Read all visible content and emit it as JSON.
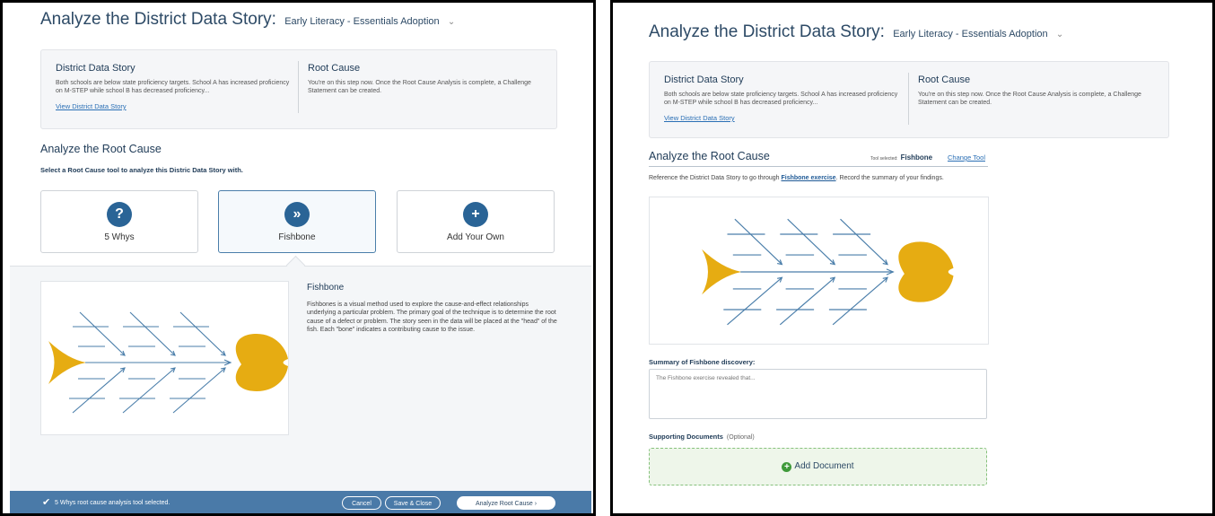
{
  "header": {
    "title": "Analyze the District Data Story:",
    "plan": "Early Literacy - Essentials Adoption",
    "chevron_icon": "chevron-down-icon"
  },
  "data_story": {
    "heading": "District Data Story",
    "text": "Both schools are below state proficiency targets. School A has increased proficiency on M-STEP while school B has decreased proficiency...",
    "link": "View District Data Story"
  },
  "root_cause": {
    "heading": "Root Cause",
    "text": "You're on this step now. Once the Root Cause Analysis is complete, a Challenge Statement can be created."
  },
  "left": {
    "section_title": "Analyze the Root Cause",
    "prompt": "Select a Root Cause tool to analyze this Distric Data Story with.",
    "tools": [
      {
        "label": "5 Whys",
        "glyph": "?",
        "icon": "question-icon"
      },
      {
        "label": "Fishbone",
        "glyph": "»",
        "icon": "double-chevron-right-icon"
      },
      {
        "label": "Add Your Own",
        "glyph": "+",
        "icon": "plus-icon"
      }
    ],
    "selected_tool_index": 1,
    "description": {
      "title": "Fishbone",
      "text": "Fishbones is a visual method used to explore the cause-and-effect relationships underlying a particular problem. The primary goal of the technique is to determine the root cause of a defect or problem. The story seen in the data will be placed at the \"head\" of the fish. Each \"bone\" indicates a contributing cause to the issue."
    },
    "footer": {
      "status": "5 Whys root cause analysis tool selected.",
      "cancel": "Cancel",
      "save_close": "Save & Close",
      "analyze": "Analyze Root Cause ›"
    }
  },
  "right": {
    "section_title": "Analyze the Root Cause",
    "tool_selected_label": "Tool selected:",
    "tool_selected_value": "Fishbone",
    "change_tool": "Change Tool",
    "reference_prefix": "Reference the District Data Story to go through ",
    "reference_link": "Fishbone exercise",
    "reference_suffix": ". Record the summary of your findings.",
    "summary_label": "Summary of Fishbone discovery:",
    "summary_placeholder": "The Fishbone exercise revealed that...",
    "supporting_label": "Supporting Documents",
    "optional": "(Optional)",
    "add_document": "Add Document"
  },
  "colors": {
    "fish": "#e6ac12",
    "bone": "#4a7eaa",
    "footer": "#4a7aa8",
    "accent": "#2a6496"
  }
}
